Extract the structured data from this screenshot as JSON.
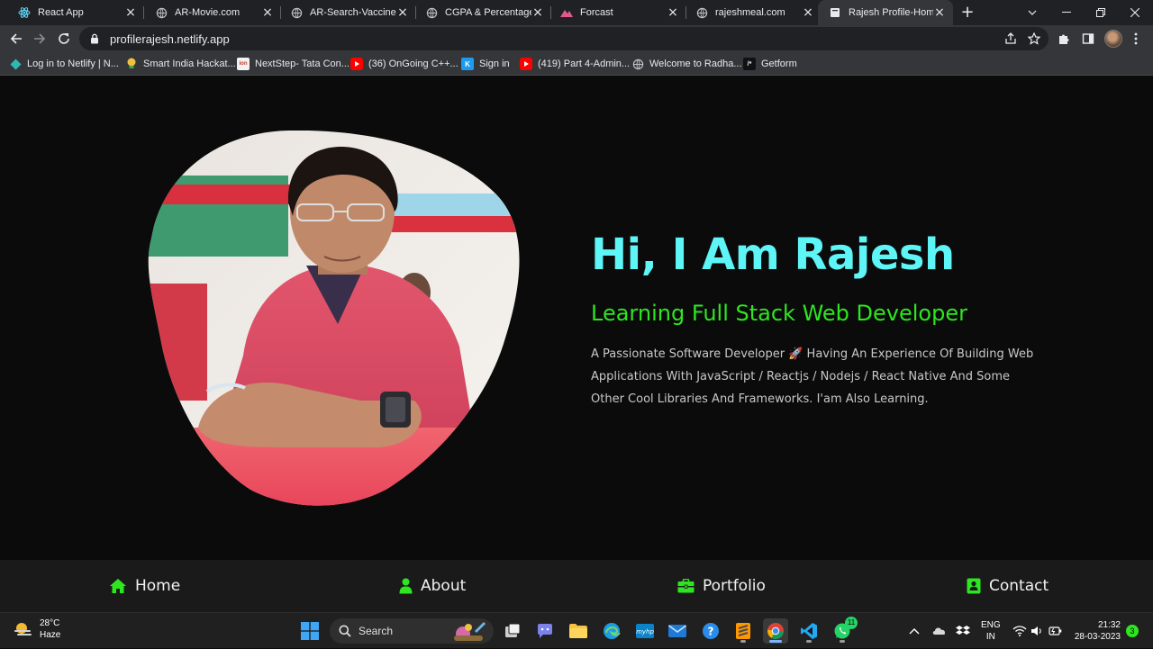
{
  "browser": {
    "tabs": [
      {
        "title": "React App",
        "favicon": "react-icon",
        "active": false
      },
      {
        "title": "AR-Movie.com",
        "favicon": "globe-icon",
        "active": false
      },
      {
        "title": "AR-Search-Vaccine-pu",
        "favicon": "globe-icon",
        "active": false
      },
      {
        "title": "CGPA & Percentage",
        "favicon": "globe-icon",
        "active": false
      },
      {
        "title": "Forcast",
        "favicon": "mountain-icon",
        "active": false
      },
      {
        "title": "rajeshmeal.com",
        "favicon": "globe-icon",
        "active": false
      },
      {
        "title": "Rajesh Profile-Home",
        "favicon": "page-icon",
        "active": true
      }
    ],
    "url": "profilerajesh.netlify.app",
    "bookmarks": [
      {
        "label": "Log in to Netlify | N...",
        "icon": "netlify-icon"
      },
      {
        "label": "Smart India Hackat...",
        "icon": "bulb-icon"
      },
      {
        "label": "NextStep- Tata Con...",
        "icon": "tcs-icon"
      },
      {
        "label": "(36) OnGoing C++...",
        "icon": "youtube-icon"
      },
      {
        "label": "Sign in",
        "icon": "sign-in-icon"
      },
      {
        "label": "(419) Part 4-Admin...",
        "icon": "youtube-icon"
      },
      {
        "label": "Welcome to Radha...",
        "icon": "globe-icon"
      },
      {
        "label": "Getform",
        "icon": "getform-icon"
      }
    ]
  },
  "hero": {
    "title": "Hi, I Am Rajesh",
    "subtitle": "Learning Full Stack Web Developer",
    "description": "A Passionate Software Developer 🚀 Having An Experience Of Building Web Applications With JavaScript / Reactjs / Nodejs / React Native And Some Other Cool Libraries And Frameworks. I'am Also Learning.",
    "accent_title": "#5ef5f7",
    "accent_subtitle": "#2ee61f"
  },
  "nav": {
    "items": [
      {
        "label": "Home",
        "icon": "house-icon"
      },
      {
        "label": "About",
        "icon": "user-icon"
      },
      {
        "label": "Portfolio",
        "icon": "briefcase-icon"
      },
      {
        "label": "Contact",
        "icon": "address-book-icon"
      }
    ],
    "icon_color": "#2ee61f"
  },
  "taskbar": {
    "weather": {
      "temp": "28°C",
      "condition": "Haze"
    },
    "search_label": "Search",
    "lang": {
      "line1": "ENG",
      "line2": "IN"
    },
    "time": "21:32",
    "date": "28-03-2023",
    "notifications": "3",
    "whatsapp_badge": "11"
  }
}
